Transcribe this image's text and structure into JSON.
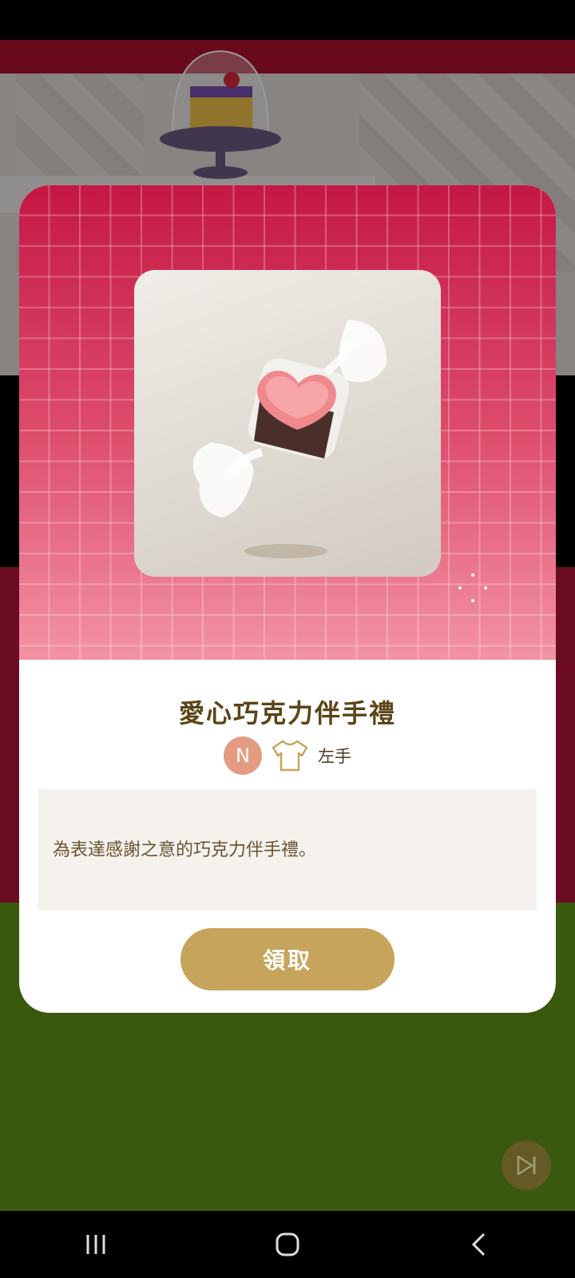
{
  "dialog": {
    "item_name": "愛心巧克力伴手禮",
    "rarity": "N",
    "slot_icon": "shirt-icon",
    "slot_label": "左手",
    "description": "為表達感謝之意的巧克力伴手禮。",
    "claim_label": "領取"
  },
  "icons": {
    "skip": "skip-forward-icon",
    "nav_recents": "recents-icon",
    "nav_home": "home-icon",
    "nav_back": "back-icon"
  },
  "colors": {
    "header_top": "#c41844",
    "header_bottom": "#f393a4",
    "title": "#5b4416",
    "rarity_badge": "#e39b81",
    "claim_button": "#c6a45c",
    "desc_bg": "#f5f2ee"
  }
}
